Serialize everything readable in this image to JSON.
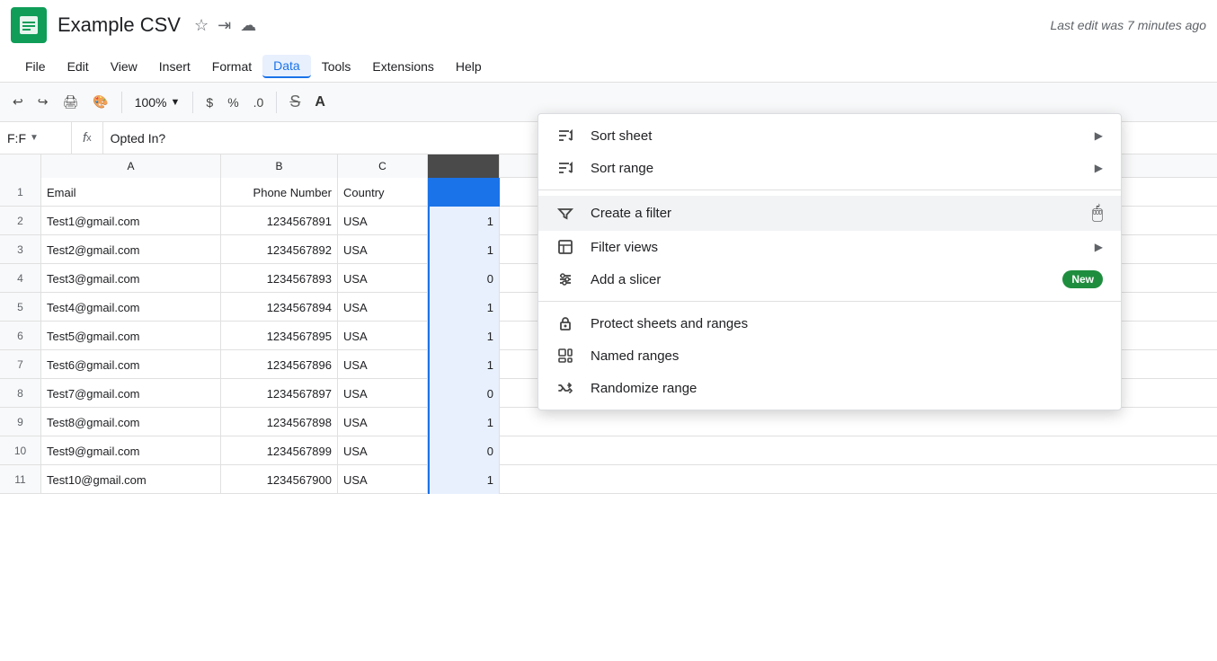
{
  "titleBar": {
    "appName": "Example CSV",
    "lastEdit": "Last edit was 7 minutes ago"
  },
  "menuBar": {
    "items": [
      "File",
      "Edit",
      "View",
      "Insert",
      "Format",
      "Data",
      "Tools",
      "Extensions",
      "Help"
    ]
  },
  "toolbar": {
    "zoom": "100%",
    "undo": "↩",
    "redo": "↪",
    "print": "🖨",
    "paintFormat": "🎨",
    "dollar": "$",
    "percent": "%",
    "decimal": ".0"
  },
  "formulaBar": {
    "cellRef": "F:F",
    "formula": "Opted In?"
  },
  "columns": {
    "headers": [
      "",
      "A",
      "B",
      "C"
    ],
    "a": "Email",
    "b": "Phone Number",
    "c": "Country"
  },
  "rows": [
    {
      "num": "1",
      "email": "Email",
      "phone": "Phone Number",
      "country": "Country",
      "last": ""
    },
    {
      "num": "2",
      "email": "Test1@gmail.com",
      "phone": "1234567891",
      "country": "USA",
      "last": "1"
    },
    {
      "num": "3",
      "email": "Test2@gmail.com",
      "phone": "1234567892",
      "country": "USA",
      "last": "1"
    },
    {
      "num": "4",
      "email": "Test3@gmail.com",
      "phone": "1234567893",
      "country": "USA",
      "last": "0"
    },
    {
      "num": "5",
      "email": "Test4@gmail.com",
      "phone": "1234567894",
      "country": "USA",
      "last": "1"
    },
    {
      "num": "6",
      "email": "Test5@gmail.com",
      "phone": "1234567895",
      "country": "USA",
      "last": "1"
    },
    {
      "num": "7",
      "email": "Test6@gmail.com",
      "phone": "1234567896",
      "country": "USA",
      "last": "1"
    },
    {
      "num": "8",
      "email": "Test7@gmail.com",
      "phone": "1234567897",
      "country": "USA",
      "last": "0"
    },
    {
      "num": "9",
      "email": "Test8@gmail.com",
      "phone": "1234567898",
      "country": "USA",
      "last": "1"
    },
    {
      "num": "10",
      "email": "Test9@gmail.com",
      "phone": "1234567899",
      "country": "USA",
      "last": "0"
    },
    {
      "num": "11",
      "email": "Test10@gmail.com",
      "phone": "1234567900",
      "country": "USA",
      "last": "1"
    }
  ],
  "dataMenu": {
    "items": [
      {
        "id": "sort-sheet",
        "label": "Sort sheet",
        "icon": "sort",
        "hasArrow": true
      },
      {
        "id": "sort-range",
        "label": "Sort range",
        "icon": "sort",
        "hasArrow": true
      },
      {
        "id": "create-filter",
        "label": "Create a filter",
        "icon": "filter",
        "hasArrow": false,
        "highlighted": true
      },
      {
        "id": "filter-views",
        "label": "Filter views",
        "icon": "filter-views",
        "hasArrow": true
      },
      {
        "id": "add-slicer",
        "label": "Add a slicer",
        "icon": "slicer",
        "hasArrow": false,
        "badge": "New"
      },
      {
        "id": "protect-sheets",
        "label": "Protect sheets and ranges",
        "icon": "lock",
        "hasArrow": false
      },
      {
        "id": "named-ranges",
        "label": "Named ranges",
        "icon": "named",
        "hasArrow": false
      },
      {
        "id": "randomize-range",
        "label": "Randomize range",
        "icon": "randomize",
        "hasArrow": false
      }
    ]
  }
}
